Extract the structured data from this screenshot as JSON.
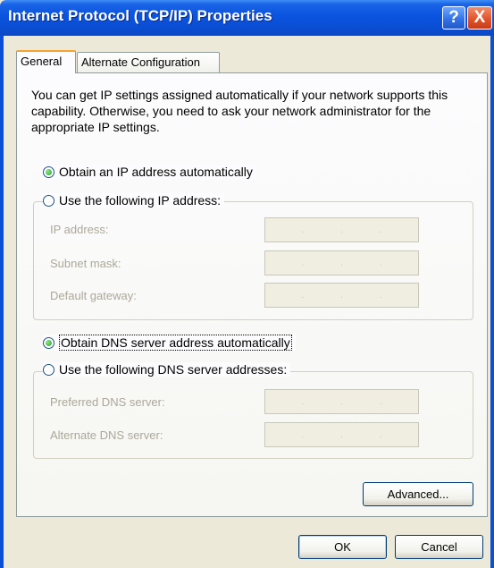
{
  "window": {
    "title": "Internet Protocol (TCP/IP) Properties",
    "help_label": "?",
    "close_label": "X"
  },
  "tabs": [
    {
      "label": "General",
      "selected": true
    },
    {
      "label": "Alternate Configuration",
      "selected": false
    }
  ],
  "description": "You can get IP settings assigned automatically if your network supports this capability. Otherwise, you need to ask your network administrator for the appropriate IP settings.",
  "ip_section": {
    "auto_label": "Obtain an IP address automatically",
    "manual_label": "Use the following IP address:",
    "auto_selected": true,
    "fields": [
      {
        "label": "IP address:",
        "value": ""
      },
      {
        "label": "Subnet mask:",
        "value": ""
      },
      {
        "label": "Default gateway:",
        "value": ""
      }
    ]
  },
  "dns_section": {
    "auto_label": "Obtain DNS server address automatically",
    "manual_label": "Use the following DNS server addresses:",
    "auto_selected": true,
    "fields": [
      {
        "label": "Preferred DNS server:",
        "value": ""
      },
      {
        "label": "Alternate DNS server:",
        "value": ""
      }
    ]
  },
  "buttons": {
    "advanced": "Advanced...",
    "ok": "OK",
    "cancel": "Cancel"
  },
  "colors": {
    "titlebar": "#0a4fd6",
    "tab_highlight": "#f4a332",
    "radio_dot": "#2a9d2a"
  },
  "icons": {
    "ip_box_separator": "."
  }
}
